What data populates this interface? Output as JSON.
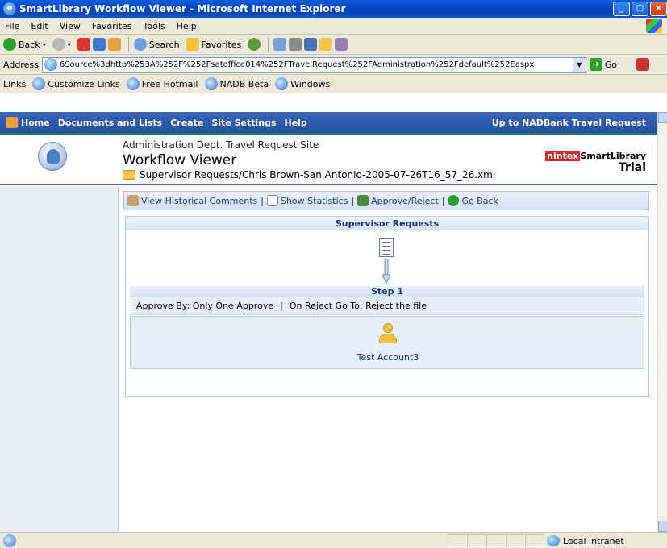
{
  "window": {
    "title": "SmartLibrary Workflow Viewer - Microsoft Internet Explorer"
  },
  "menu": [
    "File",
    "Edit",
    "View",
    "Favorites",
    "Tools",
    "Help"
  ],
  "toolbar": {
    "back": "Back",
    "search": "Search",
    "favorites": "Favorites"
  },
  "address": {
    "label": "Address",
    "value": "6Source%3dhttp%253A%252F%252Fsatoffice014%252FTravelRequest%252FAdministration%252Fdefault%252Easpx",
    "go": "Go"
  },
  "links": {
    "label": "Links",
    "items": [
      "Customize Links",
      "Free Hotmail",
      "NADB Beta",
      "Windows"
    ]
  },
  "nav": {
    "items": [
      "Home",
      "Documents and Lists",
      "Create",
      "Site Settings",
      "Help"
    ],
    "up": "Up to NADBank Travel Request"
  },
  "site": {
    "subtitle": "Administration Dept. Travel Request Site",
    "title": "Workflow Viewer",
    "path": "Supervisor Requests/Chris Brown-San Antonio-2005-07-26T16_57_26.xml"
  },
  "brand": {
    "nintex": "nintex",
    "product": "SmartLibrary",
    "edition": "Trial"
  },
  "actions": {
    "historical": "View Historical Comments",
    "statistics": "Show Statistics",
    "approve": "Approve/Reject",
    "back": "Go Back"
  },
  "workflow": {
    "header": "Supervisor Requests",
    "step_title": "Step 1",
    "approve_by": "Approve By: Only One Approve",
    "on_reject": "On Reject Go To: Reject the file",
    "user": "Test Account3"
  },
  "status": {
    "zone": "Local intranet"
  },
  "colors": {
    "nav": "#2e5aaa",
    "accent": "#18804a",
    "brand_red": "#d02a2a"
  }
}
